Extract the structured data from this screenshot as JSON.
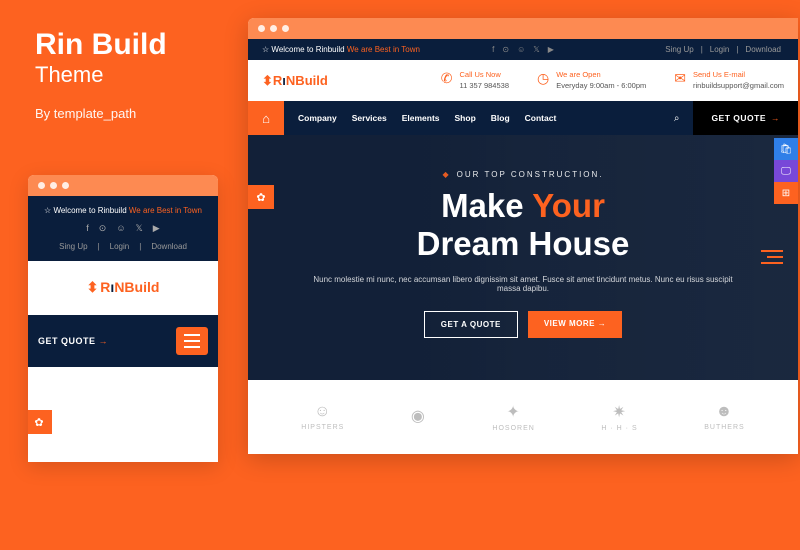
{
  "promo": {
    "title": "Rin Build",
    "subtitle": "Theme",
    "by": "By template_path"
  },
  "topbar": {
    "welcome": "Welcome to Rinbuild",
    "tagline": "We are Best in Town",
    "links": [
      "Sing Up",
      "Login",
      "Download"
    ]
  },
  "contact": {
    "call_label": "Call Us Now",
    "call_val": "11 357 984538",
    "open_label": "We are Open",
    "open_val": "Everyday 9:00am - 6:00pm",
    "mail_label": "Send Us E-mail",
    "mail_val": "rinbuildsupport@gmail.com"
  },
  "nav": {
    "items": [
      "Company",
      "Services",
      "Elements",
      "Shop",
      "Blog",
      "Contact"
    ],
    "quote": "GET QUOTE"
  },
  "hero": {
    "tag": "OUR TOP CONSTRUCTION.",
    "h1": "Make",
    "h2": "Your",
    "h3": "Dream House",
    "text": "Nunc molestie mi nunc, nec accumsan libero dignissim sit amet. Fusce sit amet tincidunt metus. Nunc eu risus suscipit massa dapibu.",
    "btn1": "GET A QUOTE",
    "btn2": "VIEW MORE"
  },
  "logos": [
    "HIPSTERS",
    "",
    "HOSOREN",
    "H · H · S",
    "BUTHERS"
  ],
  "logo": {
    "r": "R",
    "n": "NBuild",
    "brand": "RIN"
  }
}
